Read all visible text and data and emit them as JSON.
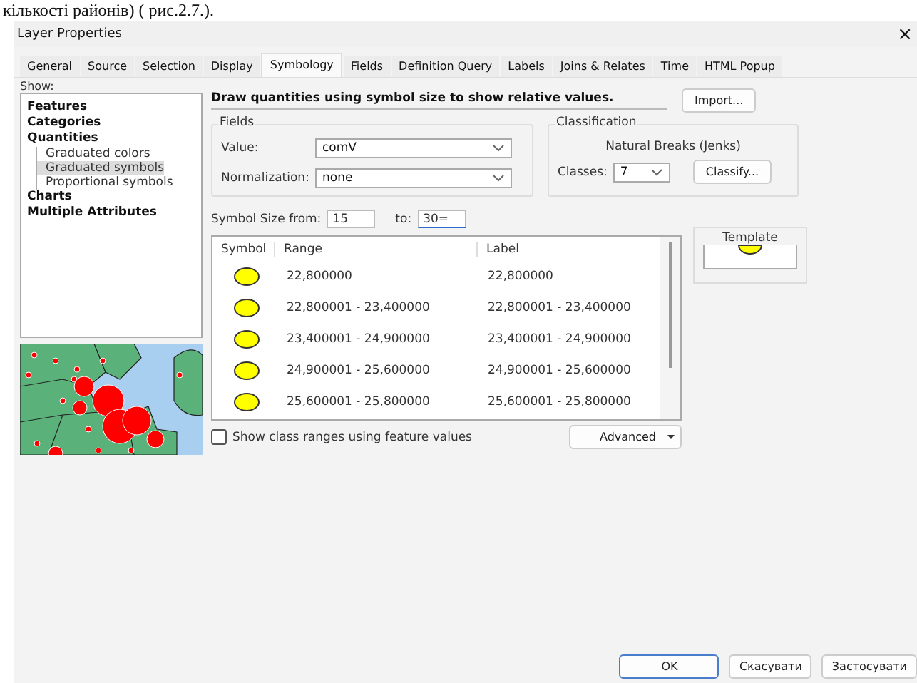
{
  "document_text": "кількості районів) ( рис.2.7.).",
  "window": {
    "title": "Layer Properties",
    "close": "×"
  },
  "tabs": [
    {
      "label": "General",
      "selected": false
    },
    {
      "label": "Source",
      "selected": false
    },
    {
      "label": "Selection",
      "selected": false
    },
    {
      "label": "Display",
      "selected": false
    },
    {
      "label": "Symbology",
      "selected": true
    },
    {
      "label": "Fields",
      "selected": false
    },
    {
      "label": "Definition Query",
      "selected": false
    },
    {
      "label": "Labels",
      "selected": false
    },
    {
      "label": "Joins & Relates",
      "selected": false
    },
    {
      "label": "Time",
      "selected": false
    },
    {
      "label": "HTML Popup",
      "selected": false
    }
  ],
  "show": {
    "label": "Show:",
    "items": [
      {
        "label": "Features",
        "selected": false
      },
      {
        "label": "Categories",
        "selected": false
      },
      {
        "label": "Quantities",
        "selected": false,
        "children": [
          {
            "label": "Graduated colors",
            "selected": false
          },
          {
            "label": "Graduated symbols",
            "selected": true
          },
          {
            "label": "Proportional symbols",
            "selected": false
          }
        ]
      },
      {
        "label": "Charts",
        "selected": false
      },
      {
        "label": "Multiple Attributes",
        "selected": false
      }
    ]
  },
  "description": "Draw quantities using symbol size to show relative values.",
  "import_button": "Import...",
  "fields": {
    "title": "Fields",
    "value_label": "Value:",
    "value": "comV",
    "normalization_label": "Normalization:",
    "normalization": "none"
  },
  "classification": {
    "title": "Classification",
    "method": "Natural Breaks (Jenks)",
    "classes_label": "Classes:",
    "classes": "7",
    "classify_button": "Classify..."
  },
  "symbol_size": {
    "from_label": "Symbol Size from:",
    "from": "15",
    "to_label": "to:",
    "to": "30="
  },
  "template": {
    "title": "Template"
  },
  "table": {
    "columns": [
      "Symbol",
      "Range",
      "Label"
    ],
    "rows": [
      {
        "range": "22,800000",
        "label": "22,800000"
      },
      {
        "range": "22,800001 - 23,400000",
        "label": "22,800001 - 23,400000"
      },
      {
        "range": "23,400001 - 24,900000",
        "label": "23,400001 - 24,900000"
      },
      {
        "range": "24,900001 - 25,600000",
        "label": "24,900001 - 25,600000"
      },
      {
        "range": "25,600001 - 25,800000",
        "label": "25,600001 - 25,800000"
      }
    ]
  },
  "show_class_ranges": {
    "label": "Show class ranges using feature values",
    "checked": false
  },
  "advanced_button": "Advanced",
  "buttons": [
    "OK",
    "Скасувати",
    "Застосувати"
  ]
}
